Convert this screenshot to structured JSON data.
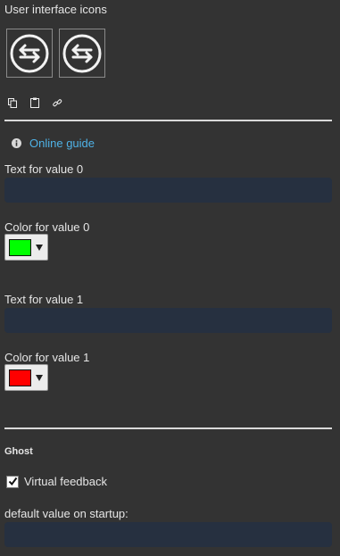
{
  "ui_icons": {
    "title": "User interface icons",
    "tiles": [
      {
        "icon": "swap-arrows-icon"
      },
      {
        "icon": "swap-arrows-icon"
      }
    ],
    "tools": [
      {
        "icon": "copy-icon"
      },
      {
        "icon": "paste-icon"
      },
      {
        "icon": "link-icon"
      }
    ]
  },
  "guide": {
    "icon": "info-icon",
    "link_label": "Online guide"
  },
  "value0": {
    "text_label": "Text for value 0",
    "text_value": "",
    "color_label": "Color for value 0",
    "color": "#00ff00"
  },
  "value1": {
    "text_label": "Text for value 1",
    "text_value": "",
    "color_label": "Color for value 1",
    "color": "#ff0000"
  },
  "ghost": {
    "title": "Ghost",
    "virtual_feedback_label": "Virtual feedback",
    "virtual_feedback_checked": true,
    "default_value_label": "default value on startup:",
    "default_value": ""
  },
  "colors": {
    "background": "#333333",
    "field_bg": "#263040",
    "link": "#4fb2e6",
    "divider": "#d9d9d9"
  }
}
